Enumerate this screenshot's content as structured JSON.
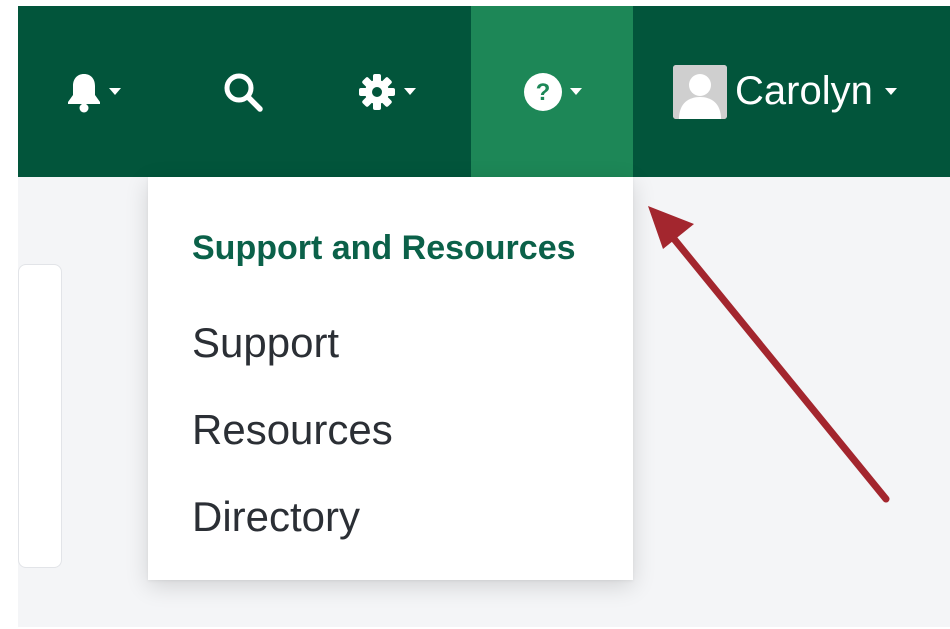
{
  "topbar": {
    "icons": {
      "notifications": "bell-icon",
      "search": "search-icon",
      "settings": "gear-icon",
      "help": "question-circle-icon"
    },
    "user": {
      "name": "Carolyn",
      "avatar_icon": "user-avatar-icon"
    }
  },
  "dropdown": {
    "header": "Support and Resources",
    "items": [
      {
        "label": "Support"
      },
      {
        "label": "Resources"
      },
      {
        "label": "Directory"
      }
    ]
  },
  "annotation": {
    "type": "arrow",
    "color": "#a3262e",
    "points_to": "help-menu"
  },
  "colors": {
    "topbar": "#02553b",
    "active_tab": "#1d8757",
    "header_text": "#0b6149",
    "background": "#f4f5f7"
  }
}
